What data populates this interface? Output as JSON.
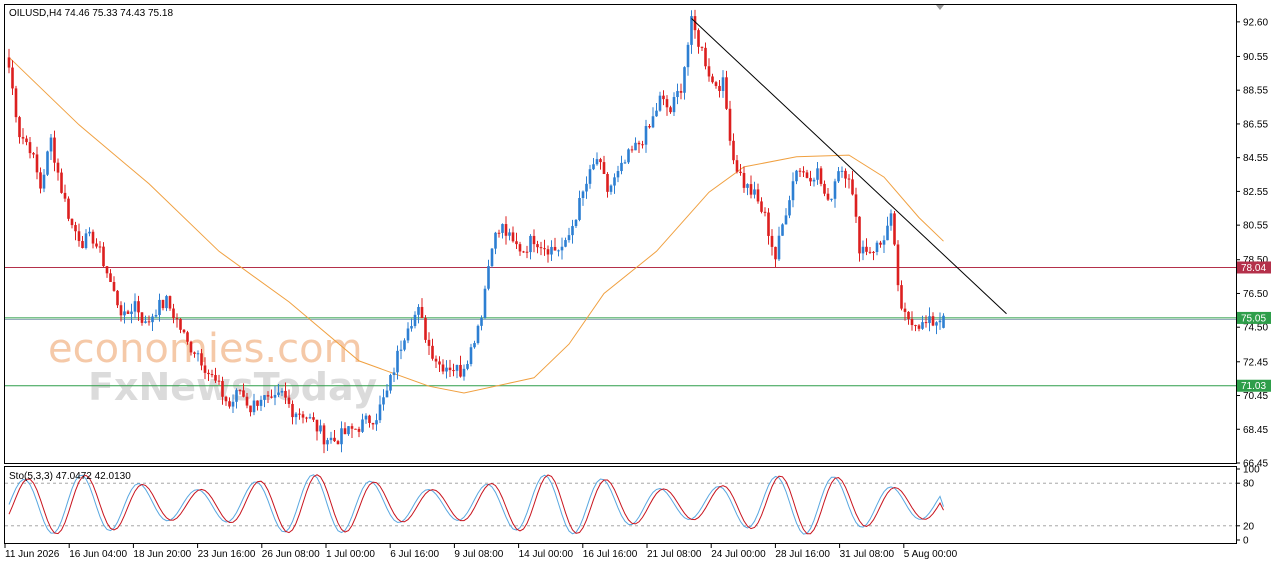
{
  "header": {
    "symbol_line": "OILUSD,H4  74.46 75.33 74.43 75.18",
    "stoch_line": "Sto(5,3,3) 47.0472 42.0130"
  },
  "watermark": {
    "line1": "economies.com",
    "line2": "FxNewsToday"
  },
  "colors": {
    "bull": "#2d7fd2",
    "bear": "#dc1f1f",
    "ma": "#f0a040",
    "trendline": "#000000",
    "resistance": "#b4304a",
    "support": "#2e9e4a",
    "stoch_main": "#5aa8e0",
    "stoch_signal": "#c8141e"
  },
  "price_axis": {
    "ticks": [
      "92.60",
      "90.55",
      "88.55",
      "86.55",
      "84.55",
      "82.55",
      "80.55",
      "78.50",
      "76.50",
      "74.50",
      "72.45",
      "70.45",
      "68.45",
      "66.45"
    ]
  },
  "stoch_axis": {
    "ticks": [
      "100",
      "80",
      "20",
      "0"
    ]
  },
  "time_axis": {
    "labels": [
      "11 Jun 2026",
      "16 Jun 04:00",
      "18 Jun 20:00",
      "23 Jun 16:00",
      "26 Jun 08:00",
      "1 Jul 00:00",
      "6 Jul 16:00",
      "9 Jul 08:00",
      "14 Jul 00:00",
      "16 Jul 16:00",
      "21 Jul 08:00",
      "24 Jul 00:00",
      "28 Jul 16:00",
      "31 Jul 08:00",
      "5 Aug 00:00"
    ]
  },
  "levels": [
    {
      "label": "78.04",
      "value": 78.04,
      "kind": "resistance"
    },
    {
      "label": "75.05",
      "value": 75.05,
      "kind": "current"
    },
    {
      "label": "71.03",
      "value": 71.03,
      "kind": "support"
    }
  ],
  "chart_data": {
    "type": "candlestick",
    "symbol": "OILUSD",
    "timeframe": "H4",
    "last_bar": {
      "open": 74.46,
      "high": 75.33,
      "low": 74.43,
      "close": 75.18
    },
    "ylim": [
      66.45,
      93.6
    ],
    "x_ticks": [
      "11 Jun 2026",
      "16 Jun 04:00",
      "18 Jun 20:00",
      "23 Jun 16:00",
      "26 Jun 08:00",
      "1 Jul 00:00",
      "6 Jul 16:00",
      "9 Jul 08:00",
      "14 Jul 00:00",
      "16 Jul 16:00",
      "21 Jul 08:00",
      "24 Jul 00:00",
      "28 Jul 16:00",
      "31 Jul 08:00",
      "5 Aug 00:00"
    ],
    "price_path": [
      [
        0,
        89.9
      ],
      [
        3,
        86.0
      ],
      [
        6,
        85.2
      ],
      [
        9,
        82.8
      ],
      [
        12,
        85.6
      ],
      [
        15,
        82.7
      ],
      [
        18,
        80.5
      ],
      [
        21,
        79.6
      ],
      [
        24,
        79.8
      ],
      [
        27,
        78.4
      ],
      [
        30,
        76.5
      ],
      [
        33,
        75.0
      ],
      [
        36,
        76.0
      ],
      [
        39,
        74.6
      ],
      [
        42,
        75.6
      ],
      [
        45,
        76.0
      ],
      [
        48,
        74.9
      ],
      [
        51,
        73.5
      ],
      [
        54,
        73.0
      ],
      [
        57,
        71.8
      ],
      [
        60,
        70.9
      ],
      [
        63,
        69.8
      ],
      [
        66,
        70.8
      ],
      [
        69,
        69.7
      ],
      [
        72,
        70.4
      ],
      [
        75,
        69.9
      ],
      [
        78,
        70.5
      ],
      [
        81,
        69.6
      ],
      [
        84,
        69.4
      ],
      [
        87,
        68.8
      ],
      [
        90,
        68.0
      ],
      [
        93,
        67.8
      ],
      [
        96,
        68.2
      ],
      [
        99,
        68.5
      ],
      [
        102,
        68.9
      ],
      [
        105,
        69.3
      ],
      [
        108,
        70.6
      ],
      [
        111,
        72.8
      ],
      [
        114,
        74.8
      ],
      [
        117,
        75.4
      ],
      [
        120,
        73.4
      ],
      [
        123,
        72.3
      ],
      [
        126,
        72.2
      ],
      [
        129,
        71.9
      ],
      [
        132,
        73.2
      ],
      [
        135,
        75.4
      ],
      [
        138,
        79.6
      ],
      [
        141,
        80.4
      ],
      [
        144,
        79.4
      ],
      [
        147,
        79.1
      ],
      [
        150,
        79.8
      ],
      [
        153,
        79.3
      ],
      [
        156,
        79.1
      ],
      [
        159,
        79.3
      ],
      [
        162,
        81.2
      ],
      [
        165,
        83.0
      ],
      [
        168,
        84.5
      ],
      [
        171,
        82.6
      ],
      [
        174,
        83.5
      ],
      [
        177,
        84.6
      ],
      [
        180,
        85.4
      ],
      [
        183,
        86.3
      ],
      [
        186,
        88.0
      ],
      [
        189,
        87.3
      ],
      [
        192,
        88.8
      ],
      [
        195,
        92.5
      ],
      [
        198,
        90.9
      ],
      [
        201,
        89.0
      ],
      [
        204,
        88.9
      ],
      [
        207,
        84.5
      ],
      [
        210,
        83.0
      ],
      [
        213,
        82.3
      ],
      [
        216,
        81.0
      ],
      [
        219,
        78.6
      ],
      [
        222,
        81.5
      ],
      [
        225,
        84.0
      ],
      [
        228,
        83.5
      ],
      [
        231,
        83.7
      ],
      [
        234,
        81.7
      ],
      [
        237,
        84.0
      ],
      [
        240,
        83.6
      ],
      [
        243,
        79.3
      ],
      [
        246,
        79.1
      ],
      [
        249,
        79.4
      ],
      [
        252,
        80.9
      ],
      [
        255,
        75.2
      ],
      [
        258,
        75.0
      ],
      [
        261,
        74.6
      ],
      [
        264,
        74.8
      ],
      [
        267,
        75.18
      ]
    ],
    "moving_average": {
      "type": "MA",
      "points": [
        [
          0,
          90.5
        ],
        [
          20,
          86.5
        ],
        [
          40,
          83.0
        ],
        [
          60,
          79.0
        ],
        [
          80,
          76.0
        ],
        [
          100,
          72.5
        ],
        [
          120,
          71.0
        ],
        [
          130,
          70.6
        ],
        [
          150,
          71.5
        ],
        [
          160,
          73.5
        ],
        [
          170,
          76.5
        ],
        [
          185,
          79.0
        ],
        [
          200,
          82.5
        ],
        [
          210,
          84.0
        ],
        [
          225,
          84.6
        ],
        [
          240,
          84.7
        ],
        [
          250,
          83.4
        ],
        [
          260,
          81.0
        ],
        [
          267,
          79.6
        ]
      ]
    },
    "trendline": {
      "from": [
        195,
        92.8
      ],
      "to": [
        285,
        75.3
      ]
    },
    "horizontal_levels": [
      78.04,
      75.05,
      71.03
    ],
    "stochastic": {
      "params": "5,3,3",
      "main": 47.0472,
      "signal": 42.013,
      "ylim": [
        0,
        100
      ],
      "levels": [
        80,
        20
      ]
    }
  }
}
